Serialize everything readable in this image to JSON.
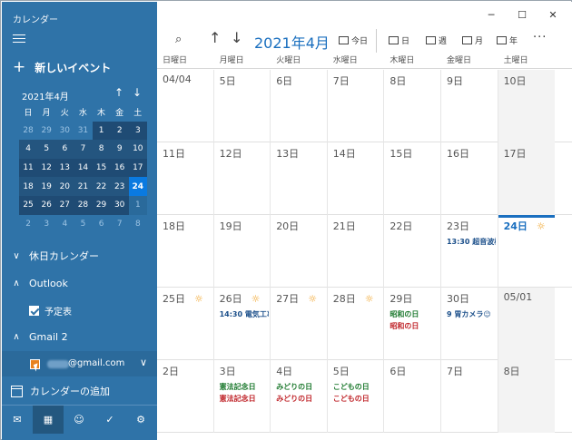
{
  "app": {
    "title": "カレンダー"
  },
  "sidebar": {
    "new_event": "新しいイベント",
    "mini_month": "2021年4月",
    "mini_dow": [
      "日",
      "月",
      "火",
      "水",
      "木",
      "金",
      "土"
    ],
    "mini_weeks": [
      [
        {
          "d": "28",
          "k": "other"
        },
        {
          "d": "29",
          "k": "other"
        },
        {
          "d": "30",
          "k": "other"
        },
        {
          "d": "31",
          "k": "other"
        },
        {
          "d": "1",
          "k": "month"
        },
        {
          "d": "2",
          "k": "month"
        },
        {
          "d": "3",
          "k": "month"
        }
      ],
      [
        {
          "d": "4",
          "k": "month"
        },
        {
          "d": "5",
          "k": "month"
        },
        {
          "d": "6",
          "k": "month"
        },
        {
          "d": "7",
          "k": "month"
        },
        {
          "d": "8",
          "k": "month"
        },
        {
          "d": "9",
          "k": "month"
        },
        {
          "d": "10",
          "k": "month"
        }
      ],
      [
        {
          "d": "11",
          "k": "month"
        },
        {
          "d": "12",
          "k": "month"
        },
        {
          "d": "13",
          "k": "month"
        },
        {
          "d": "14",
          "k": "month"
        },
        {
          "d": "15",
          "k": "month"
        },
        {
          "d": "16",
          "k": "month"
        },
        {
          "d": "17",
          "k": "month"
        }
      ],
      [
        {
          "d": "18",
          "k": "month"
        },
        {
          "d": "19",
          "k": "month"
        },
        {
          "d": "20",
          "k": "month"
        },
        {
          "d": "21",
          "k": "month"
        },
        {
          "d": "22",
          "k": "month"
        },
        {
          "d": "23",
          "k": "month"
        },
        {
          "d": "24",
          "k": "today"
        }
      ],
      [
        {
          "d": "25",
          "k": "month"
        },
        {
          "d": "26",
          "k": "month"
        },
        {
          "d": "27",
          "k": "month"
        },
        {
          "d": "28",
          "k": "month"
        },
        {
          "d": "29",
          "k": "month"
        },
        {
          "d": "30",
          "k": "month"
        },
        {
          "d": "1",
          "k": "other-dark"
        }
      ],
      [
        {
          "d": "2",
          "k": "other"
        },
        {
          "d": "3",
          "k": "other"
        },
        {
          "d": "4",
          "k": "other"
        },
        {
          "d": "5",
          "k": "other"
        },
        {
          "d": "6",
          "k": "other"
        },
        {
          "d": "7",
          "k": "other"
        },
        {
          "d": "8",
          "k": "other"
        }
      ]
    ],
    "holiday_calendar": "休日カレンダー",
    "outlook": "Outlook",
    "outlook_item": "予定表",
    "gmail": "Gmail 2",
    "gmail_account": "@gmail.com",
    "add_calendar": "カレンダーの追加"
  },
  "toolbar": {
    "title": "2021年4月",
    "today": "今日",
    "day": "日",
    "week": "週",
    "month": "月",
    "year": "年"
  },
  "dow": [
    "日曜日",
    "月曜日",
    "火曜日",
    "水曜日",
    "木曜日",
    "金曜日",
    "土曜日"
  ],
  "weeks": [
    [
      {
        "n": "04/04"
      },
      {
        "n": "5日"
      },
      {
        "n": "6日"
      },
      {
        "n": "7日"
      },
      {
        "n": "8日"
      },
      {
        "n": "9日"
      },
      {
        "n": "10日",
        "shaded": true
      }
    ],
    [
      {
        "n": "11日"
      },
      {
        "n": "12日"
      },
      {
        "n": "13日"
      },
      {
        "n": "14日"
      },
      {
        "n": "15日"
      },
      {
        "n": "16日"
      },
      {
        "n": "17日",
        "shaded": true
      }
    ],
    [
      {
        "n": "18日"
      },
      {
        "n": "19日"
      },
      {
        "n": "20日"
      },
      {
        "n": "21日"
      },
      {
        "n": "22日"
      },
      {
        "n": "23日",
        "ev": [
          {
            "t": "13:30 超音波検",
            "c": "blue"
          }
        ]
      },
      {
        "n": "24日",
        "today": true,
        "sun": true
      }
    ],
    [
      {
        "n": "25日",
        "sun": true
      },
      {
        "n": "26日",
        "sun": true,
        "ev": [
          {
            "t": "14:30 電気工事",
            "c": "blue"
          }
        ]
      },
      {
        "n": "27日",
        "sun": true
      },
      {
        "n": "28日",
        "sun": true
      },
      {
        "n": "29日",
        "ev": [
          {
            "t": "昭和の日",
            "c": "green"
          },
          {
            "t": "昭和の日",
            "c": "red"
          }
        ]
      },
      {
        "n": "30日",
        "ev": [
          {
            "t": "9 胃カメラ😉",
            "c": "blue"
          }
        ]
      },
      {
        "n": "05/01",
        "shaded": true
      }
    ],
    [
      {
        "n": "2日"
      },
      {
        "n": "3日",
        "ev": [
          {
            "t": "憲法記念日",
            "c": "green"
          },
          {
            "t": "憲法記念日",
            "c": "red"
          }
        ]
      },
      {
        "n": "4日",
        "ev": [
          {
            "t": "みどりの日",
            "c": "green"
          },
          {
            "t": "みどりの日",
            "c": "red"
          }
        ]
      },
      {
        "n": "5日",
        "ev": [
          {
            "t": "こどもの日",
            "c": "green"
          },
          {
            "t": "こどもの日",
            "c": "red"
          }
        ]
      },
      {
        "n": "6日"
      },
      {
        "n": "7日"
      },
      {
        "n": "8日",
        "shaded": true
      }
    ]
  ]
}
